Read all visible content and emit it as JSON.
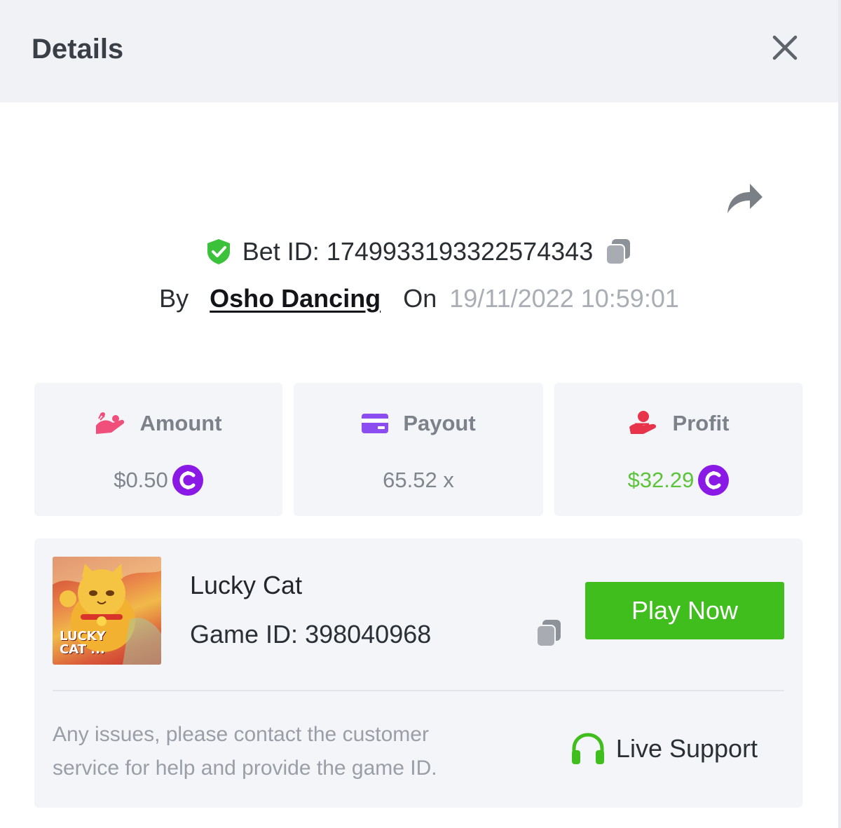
{
  "header": {
    "title": "Details"
  },
  "bet": {
    "id_label": "Bet ID:",
    "id_value": "1749933193322574343",
    "by_label": "By",
    "user": "Osho Dancing",
    "on_label": "On",
    "datetime": "19/11/2022 10:59:01"
  },
  "stats": {
    "amount": {
      "label": "Amount",
      "value": "$0.50",
      "icon": "money-hand-icon"
    },
    "payout": {
      "label": "Payout",
      "value": "65.52 x",
      "icon": "card-icon"
    },
    "profit": {
      "label": "Profit",
      "value": "$32.29",
      "icon": "profit-hand-icon"
    }
  },
  "game": {
    "name": "Lucky Cat",
    "id_label": "Game ID:",
    "id_value": "398040968",
    "thumbnail_text": "LUCKY CAT",
    "play_label": "Play Now"
  },
  "support": {
    "notice": "Any issues, please contact the customer service for help and provide the game ID.",
    "button_label": "Live Support"
  },
  "colors": {
    "accent_green": "#3fbe1e",
    "profit_green": "#5cc43a",
    "coin_purple": "#8a19e6",
    "amount_pink": "#ef4f7a",
    "payout_purple": "#8b4cf0",
    "profit_red": "#e8344a"
  }
}
